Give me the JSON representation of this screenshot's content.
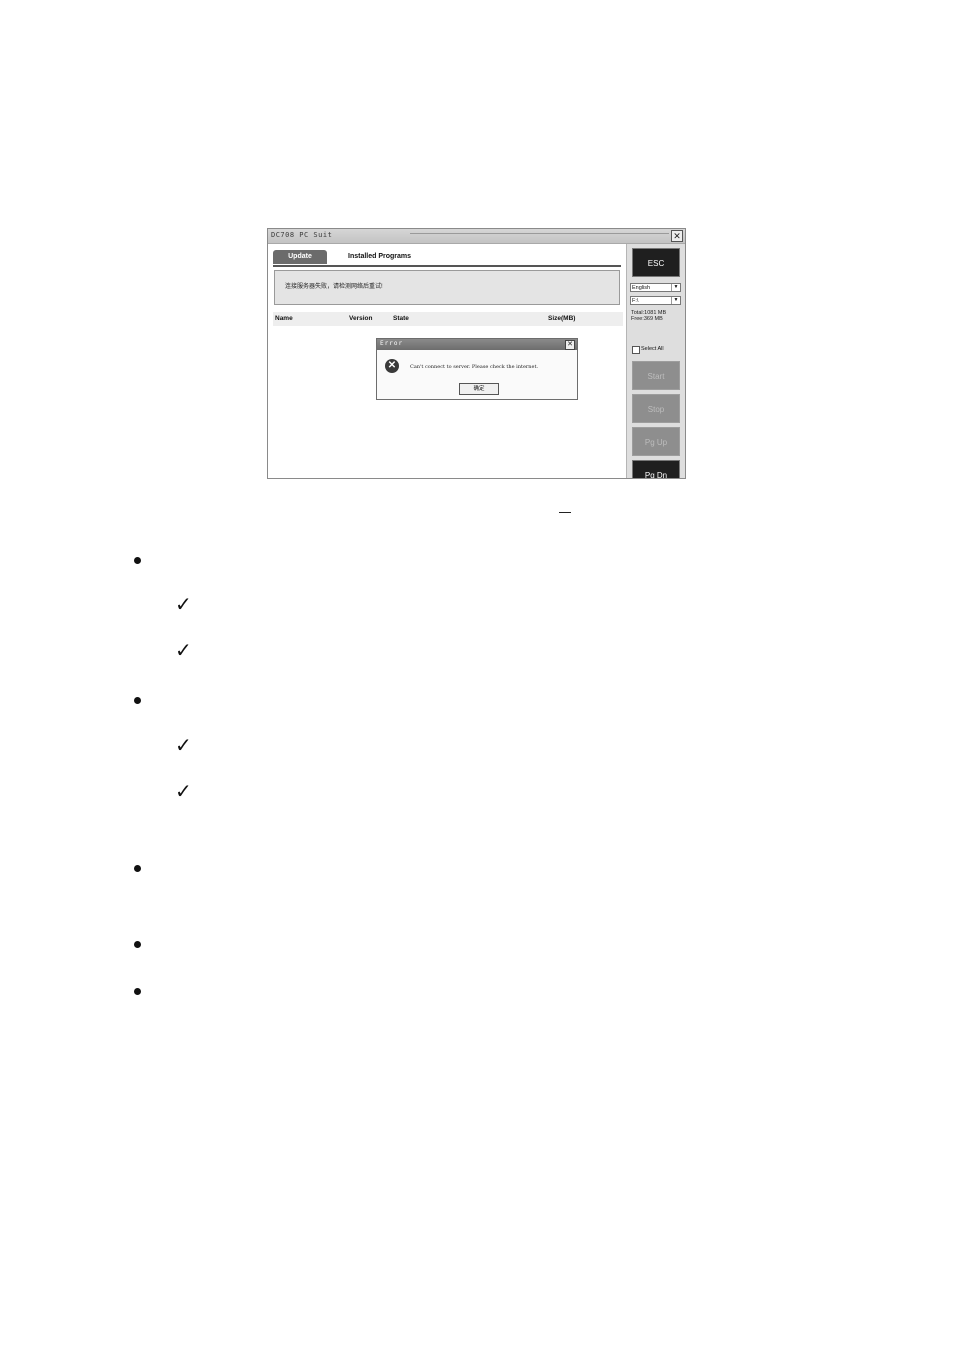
{
  "window": {
    "title": "DC708 PC Suit",
    "close_glyph": "✕"
  },
  "tabs": [
    {
      "label": "Update"
    },
    {
      "label": "Installed Programs"
    }
  ],
  "message": "连接服务器失败，请检测网络后重试!",
  "columns": [
    "Name",
    "Version",
    "State",
    "Size(MB)"
  ],
  "dialog": {
    "title": "Error",
    "message": "Can't connect to server. Please check the internet.",
    "ok_label": "确定",
    "close_glyph": "✕",
    "icon": "error-x-icon"
  },
  "sidebar": {
    "esc_label": "ESC",
    "language_value": "English",
    "drive_value": "F:\\",
    "total_label": "Total:1081 MB",
    "free_label": "Free:369 MB",
    "select_all_label": "Select All",
    "start_label": "Start",
    "stop_label": "Stop",
    "pgup_label": "Pg Up",
    "pgdn_label": "Pg Dn"
  },
  "doc": {
    "bullet_glyph": "●",
    "check_glyph": "✓"
  }
}
